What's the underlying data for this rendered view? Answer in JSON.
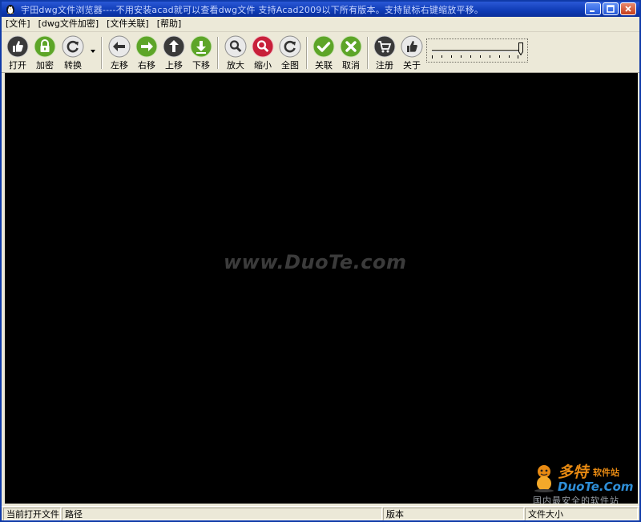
{
  "window": {
    "title": "宇田dwg文件浏览器----不用安装acad就可以查看dwg文件 支持Acad2009以下所有版本。支持鼠标右键缩放平移。",
    "app_icon": "penguin-icon",
    "controls": {
      "minimize": "minimize-icon",
      "maximize": "maximize-icon",
      "close": "close-icon"
    }
  },
  "menu": [
    {
      "label": "[文件]"
    },
    {
      "label": "[dwg文件加密]"
    },
    {
      "label": "[文件关联]"
    },
    {
      "label": "[帮助]"
    }
  ],
  "toolbar": {
    "buttons": [
      {
        "label": "打开",
        "icon": "thumbs-up-icon"
      },
      {
        "label": "加密",
        "icon": "lock-icon"
      },
      {
        "label": "转换",
        "icon": "refresh-icon"
      },
      {
        "label": "左移",
        "icon": "arrow-left-icon"
      },
      {
        "label": "右移",
        "icon": "arrow-right-icon"
      },
      {
        "label": "上移",
        "icon": "arrow-up-icon"
      },
      {
        "label": "下移",
        "icon": "arrow-down-icon"
      },
      {
        "label": "放大",
        "icon": "zoom-in-icon"
      },
      {
        "label": "缩小",
        "icon": "zoom-out-icon"
      },
      {
        "label": "全图",
        "icon": "refresh-icon"
      },
      {
        "label": "关联",
        "icon": "check-icon"
      },
      {
        "label": "取消",
        "icon": "cancel-icon"
      },
      {
        "label": "注册",
        "icon": "cart-icon"
      },
      {
        "label": "关于",
        "icon": "thumbs-up-icon"
      }
    ],
    "slider_level": 1.0
  },
  "canvas": {
    "watermark": "www.DuoTe.com",
    "brand": {
      "name": "多特",
      "sub": "软件站",
      "url": "DuoTe.Com",
      "slogan": "国内最安全的软件站"
    }
  },
  "status": [
    {
      "label": "当前打开文件"
    },
    {
      "label": "路径"
    },
    {
      "label": "版本"
    },
    {
      "label": "文件大小"
    }
  ],
  "colors": {
    "titlebar": "#0e3bb5",
    "face": "#ece9d8",
    "canvas": "#000000",
    "icon_green": "#5da528",
    "icon_dark": "#3a3a3a",
    "icon_red": "#c8203a"
  }
}
